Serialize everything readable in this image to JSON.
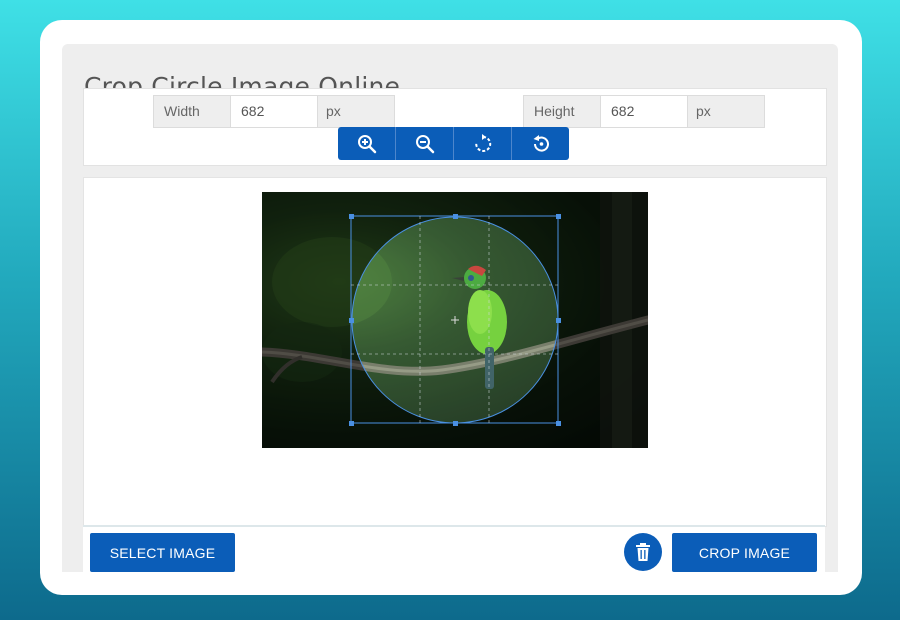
{
  "page": {
    "title": "Crop Circle Image Online"
  },
  "dimensions": {
    "width_label": "Width",
    "width_value": "682",
    "width_unit": "px",
    "height_label": "Height",
    "height_value": "682",
    "height_unit": "px"
  },
  "toolbar": {
    "buttons": [
      {
        "icon": "zoom-in-icon"
      },
      {
        "icon": "zoom-out-icon"
      },
      {
        "icon": "rotate-icon"
      },
      {
        "icon": "reset-icon"
      }
    ]
  },
  "actions": {
    "select_label": "SELECT IMAGE",
    "crop_label": "CROP IMAGE",
    "delete_icon": "trash-icon"
  },
  "colors": {
    "accent": "#0b5db8",
    "crop_frame": "#4a90e2"
  }
}
